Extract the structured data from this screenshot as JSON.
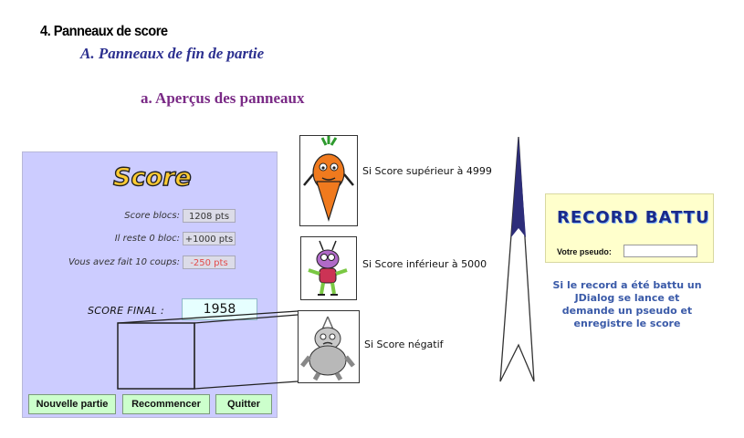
{
  "headings": {
    "section": "4.  Panneaux de score",
    "subsection": "A.  Panneaux de fin de partie",
    "subsubsection": "a.  Aperçus des panneaux"
  },
  "score_panel": {
    "title": "Score",
    "rows": [
      {
        "label": "Score blocs:",
        "value": "1208 pts"
      },
      {
        "label": "Il reste 0 bloc:",
        "value": "+1000 pts"
      },
      {
        "label": "Vous avez fait 10 coups:",
        "value": "-250 pts"
      }
    ],
    "final_label": "SCORE FINAL :",
    "final_value": "1958",
    "buttons": {
      "new_game": "Nouvelle partie",
      "restart": "Recommencer",
      "quit": "Quitter"
    }
  },
  "thumbnails": [
    {
      "caption": "Si Score supérieur à 4999"
    },
    {
      "caption": "Si Score inférieur à 5000"
    },
    {
      "caption": "Si Score négatif"
    }
  ],
  "record_dialog": {
    "title": "RECORD BATTU",
    "pseudo_label": "Votre pseudo:",
    "pseudo_value": "",
    "description": "Si le record a été battu un JDialog se lance et demande un pseudo et enregistre le score"
  },
  "colors": {
    "panel_bg": "#ccccff",
    "button_bg": "#ccffcc",
    "final_bg": "#e6ffff",
    "record_bg": "#ffffcc",
    "negative": "#e24b4b",
    "desc_text": "#3a5aa8"
  }
}
